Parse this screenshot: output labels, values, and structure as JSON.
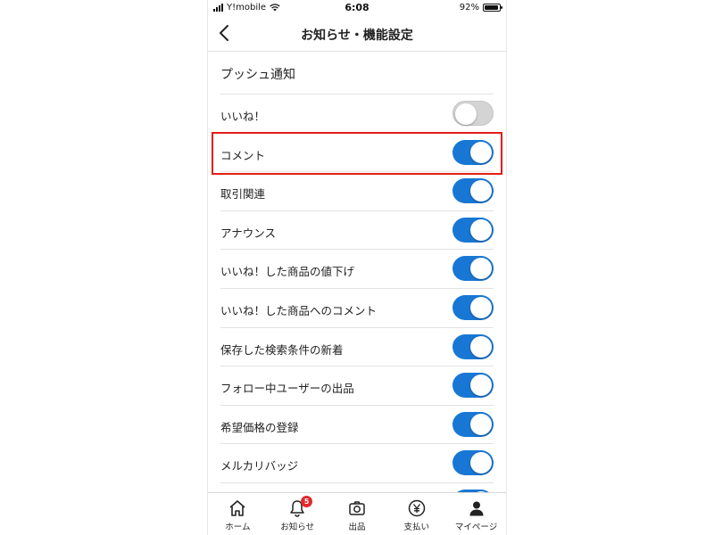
{
  "status_bar": {
    "carrier": "Y!mobile",
    "time": "6:08",
    "battery": "92%",
    "battery_level": 0.92
  },
  "nav": {
    "title": "お知らせ・機能設定",
    "back_icon": "chevron-left-icon"
  },
  "section": {
    "title": "プッシュ通知"
  },
  "settings": [
    {
      "label": "いいね！",
      "enabled": false
    },
    {
      "label": "コメント",
      "enabled": true,
      "highlighted": true
    },
    {
      "label": "取引関連",
      "enabled": true
    },
    {
      "label": "アナウンス",
      "enabled": true
    },
    {
      "label": "いいね！した商品の値下げ",
      "enabled": true
    },
    {
      "label": "いいね！した商品へのコメント",
      "enabled": true
    },
    {
      "label": "保存した検索条件の新着",
      "enabled": true
    },
    {
      "label": "フォロー中ユーザーの出品",
      "enabled": true
    },
    {
      "label": "希望価格の登録",
      "enabled": true
    },
    {
      "label": "メルカリバッジ",
      "enabled": true
    },
    {
      "label": "",
      "enabled": true
    }
  ],
  "colors": {
    "toggle_on": "#1877d4",
    "toggle_off": "#d4d4d4",
    "highlight": "#e31e16",
    "badge": "#e4272b"
  },
  "tabs": [
    {
      "label": "ホーム",
      "icon": "home-icon"
    },
    {
      "label": "お知らせ",
      "icon": "bell-icon",
      "badge": "5"
    },
    {
      "label": "出品",
      "icon": "camera-icon"
    },
    {
      "label": "支払い",
      "icon": "yen-icon"
    },
    {
      "label": "マイページ",
      "icon": "person-icon"
    }
  ]
}
